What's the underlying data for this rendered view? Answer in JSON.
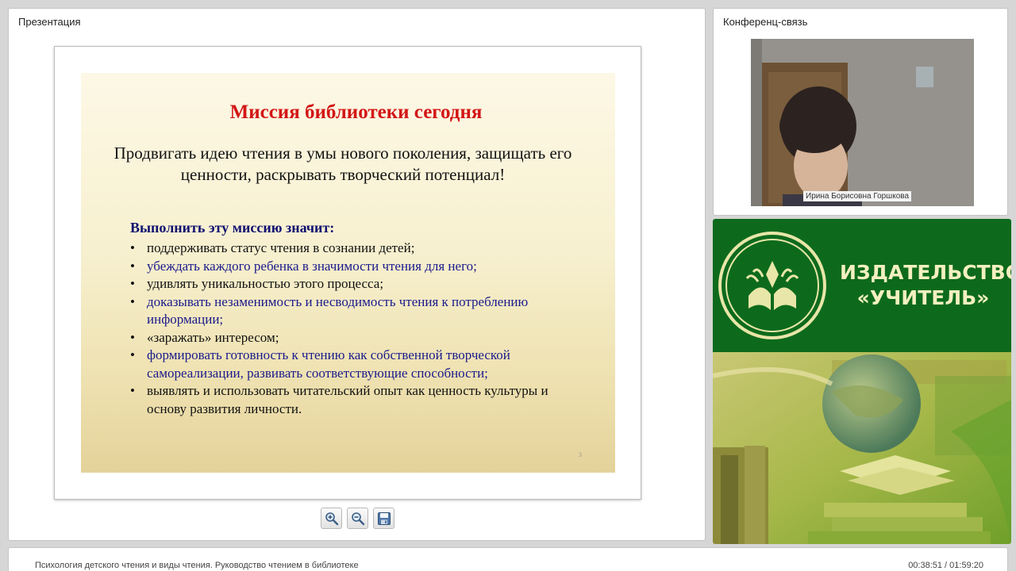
{
  "presentation": {
    "title": "Презентация",
    "slide": {
      "heading": "Миссия  библиотеки сегодня",
      "lead": "Продвигать идею чтения в умы нового поколения, защищать его ценности, раскрывать творческий потенциал!",
      "subheading": "Выполнить эту миссию значит:",
      "bullets": [
        "поддерживать статус чтения в сознании детей;",
        "убеждать каждого ребенка в значимости чтения для него;",
        "удивлять уникальностью этого процесса;",
        "доказывать незаменимость и несводимость чтения к потреблению информации;",
        "«заражать» интересом;",
        "формировать готовность к чтению как собственной творческой самореализации, развивать соответствующие способности;",
        "выявлять и использовать читательский опыт как ценность культуры и основу развития личности."
      ],
      "page_number": "3"
    },
    "toolbar": {
      "zoom_in_icon": "zoom-in-icon",
      "zoom_out_icon": "zoom-out-icon",
      "save_icon": "save-icon"
    }
  },
  "conference": {
    "title": "Конференц-связь",
    "participant_name": "Ирина Борисовна Горшкова"
  },
  "brand": {
    "name_line1": "ИЗДАТЕЛЬСТВО",
    "name_line2": "«УЧИТЕЛЬ»",
    "colors": {
      "green": "#0d6a1d",
      "cream": "#f4f0bf"
    }
  },
  "footer": {
    "lecture_title": "Психология детского чтения и виды чтения. Руководство чтением в библиотеке",
    "time": "00:38:51 / 01:59:20"
  }
}
